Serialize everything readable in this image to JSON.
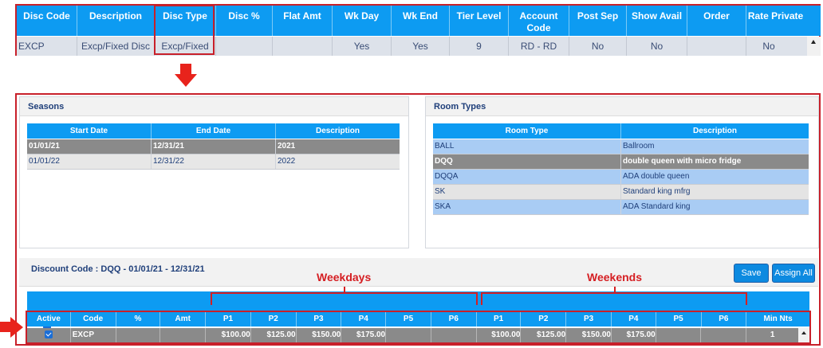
{
  "discount_grid": {
    "columns": [
      "Disc Code",
      "Description",
      "Disc Type",
      "Disc %",
      "Flat Amt",
      "Wk Day",
      "Wk End",
      "Tier Level",
      "Account Code",
      "Post Sep",
      "Show Avail",
      "Order",
      "Rate Private"
    ],
    "row": {
      "disc_code": "EXCP",
      "description": "Excp/Fixed Disc",
      "disc_type": "Excp/Fixed",
      "disc_pct": "",
      "flat_amt": "",
      "wk_day": "Yes",
      "wk_end": "Yes",
      "tier_level": "9",
      "account_code": "RD - RD",
      "post_sep": "No",
      "show_avail": "No",
      "order": "",
      "rate_private": "No"
    }
  },
  "seasons": {
    "title": "Seasons",
    "columns": [
      "Start Date",
      "End Date",
      "Description"
    ],
    "rows": [
      {
        "start": "01/01/21",
        "end": "12/31/21",
        "description": "2021",
        "selected": true
      },
      {
        "start": "01/01/22",
        "end": "12/31/22",
        "description": "2022",
        "selected": false
      }
    ]
  },
  "room_types": {
    "title": "Room Types",
    "columns": [
      "Room Type",
      "Description"
    ],
    "rows": [
      {
        "type": "BALL",
        "description": "Ballroom",
        "style": "blue"
      },
      {
        "type": "DQQ",
        "description": "double queen with micro fridge",
        "style": "selected"
      },
      {
        "type": "DQQA",
        "description": "ADA double queen",
        "style": "blue"
      },
      {
        "type": "SK",
        "description": "Standard king mfrg",
        "style": "gray"
      },
      {
        "type": "SKA",
        "description": "ADA Standard king",
        "style": "blue"
      }
    ]
  },
  "discount_section": {
    "title": "Discount Code : DQQ - 01/01/21 - 12/31/21",
    "save_label": "Save",
    "assign_all_label": "Assign All",
    "weekdays_label": "Weekdays",
    "weekends_label": "Weekends"
  },
  "rate_grid": {
    "columns": [
      "Active",
      "Code",
      "%",
      "Amt",
      "P1",
      "P2",
      "P3",
      "P4",
      "P5",
      "P6",
      "P1",
      "P2",
      "P3",
      "P4",
      "P5",
      "P6",
      "Min Nts"
    ],
    "row": {
      "active": true,
      "code": "EXCP",
      "pct": "",
      "amt": "",
      "wd_p1": "$100.00",
      "wd_p2": "$125.00",
      "wd_p3": "$150.00",
      "wd_p4": "$175.00",
      "wd_p5": "",
      "wd_p6": "",
      "we_p1": "$100.00",
      "we_p2": "$125.00",
      "we_p3": "$150.00",
      "we_p4": "$175.00",
      "we_p5": "",
      "we_p6": "",
      "min_nts": "1"
    }
  },
  "colors": {
    "header_blue": "#0d9bf2",
    "annotation_red": "#d51e22",
    "selected_row": "#8a8a8a",
    "room_row_blue": "#a9ccf4"
  },
  "icons": [
    "down-arrow-annotation-icon",
    "right-arrow-annotation-icon",
    "checkbox-checked-icon",
    "scroll-up-arrow-icon"
  ]
}
